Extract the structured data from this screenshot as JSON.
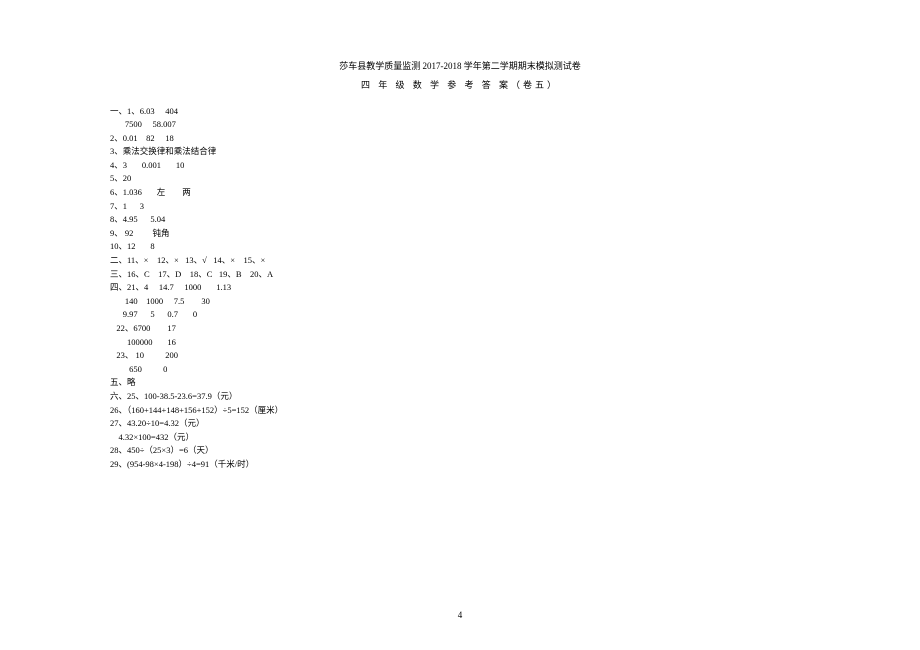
{
  "title": "莎车县教学质量监测 2017-2018 学年第二学期期末模拟测试卷",
  "subtitle": "四 年 级 数 学 参 考 答 案（卷五）",
  "lines": [
    "一、1、6.03     404",
    "       7500     58.007",
    "2、0.01    82     18",
    "3、乘法交换律和乘法结合律",
    "4、3       0.001       10",
    "5、20",
    "6、1.036       左        两",
    "7、1      3",
    "8、4.95      5.04",
    "9、 92         钝角",
    "10、12       8",
    "二、11、×    12、×   13、√   14、×    15、×",
    "三、16、C    17、D    18、C   19、B    20、A",
    "四、21、4     14.7     1000       1.13",
    "       140    1000     7.5        30",
    "      9.97      5      0.7       0",
    "   22、6700        17",
    "        100000       16",
    "   23、 10          200",
    "         650          0",
    "五、略",
    "六、25、100-38.5-23.6=37.9（元）",
    "26、（160+144+148+156+152）÷5=152（厘米）",
    "27、43.20÷10=4.32（元）",
    "    4.32×100=432（元）",
    "28、450÷（25×3）=6（天）",
    "29、(954-98×4-198）÷4=91（千米/时）"
  ],
  "page_number": "4"
}
